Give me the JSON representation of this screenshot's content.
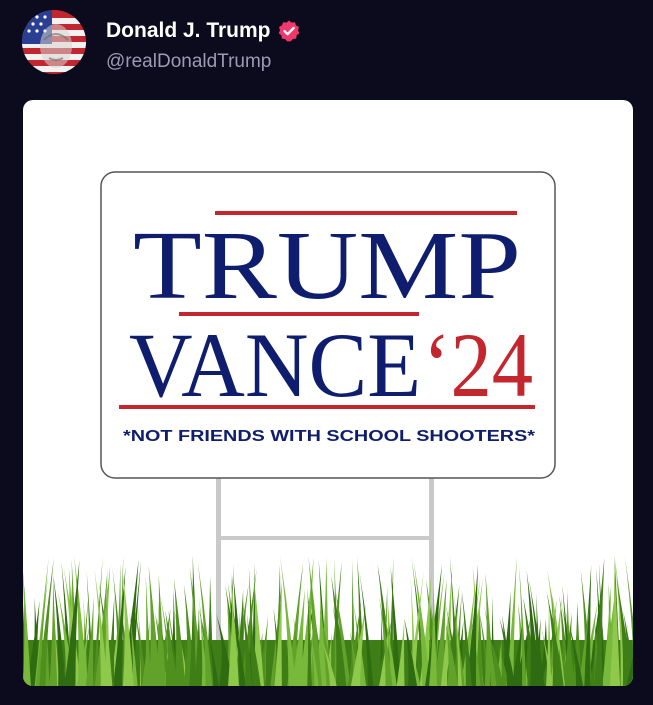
{
  "post": {
    "author": {
      "display_name": "Donald J. Trump",
      "handle": "@realDonaldTrump",
      "verified": true,
      "avatar_icon": "flag-portrait-avatar"
    },
    "media": {
      "sign": {
        "line1": "TRUMP",
        "line2_word": "VANCE",
        "line2_year": "‘24",
        "tagline": "*NOT FRIENDS WITH SCHOOL SHOOTERS*"
      },
      "colors": {
        "navy": "#0f1d6e",
        "red": "#c4262e",
        "grass": "#4f8f1e"
      }
    }
  },
  "colors": {
    "background": "#0c0b1d",
    "name": "#ffffff",
    "handle": "#9c9bb0",
    "verified_badge": "#f0386b"
  }
}
